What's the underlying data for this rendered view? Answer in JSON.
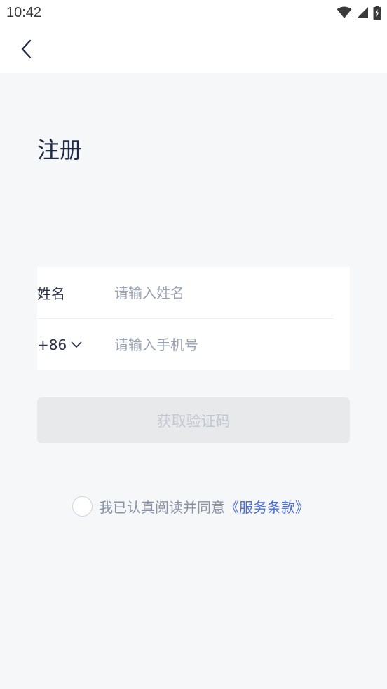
{
  "status_bar": {
    "time": "10:42",
    "icons": [
      "wifi-icon",
      "signal-icon",
      "battery-charging-icon"
    ]
  },
  "nav": {
    "back_icon": "chevron-left-icon"
  },
  "page": {
    "title": "注册"
  },
  "form": {
    "name_label": "姓名",
    "name_placeholder": "请输入姓名",
    "country_code": "+86",
    "country_code_icon": "chevron-down-icon",
    "phone_placeholder": "请输入手机号"
  },
  "actions": {
    "get_code_label": "获取验证码"
  },
  "agreement": {
    "text": "我已认真阅读并同意",
    "terms_link": "《服务条款》"
  },
  "colors": {
    "background": "#f6f7f9",
    "title": "#1f2a44",
    "link": "#4a6cdc",
    "button_disabled_bg": "#e8e9eb",
    "button_disabled_text": "#c3c7cf"
  }
}
